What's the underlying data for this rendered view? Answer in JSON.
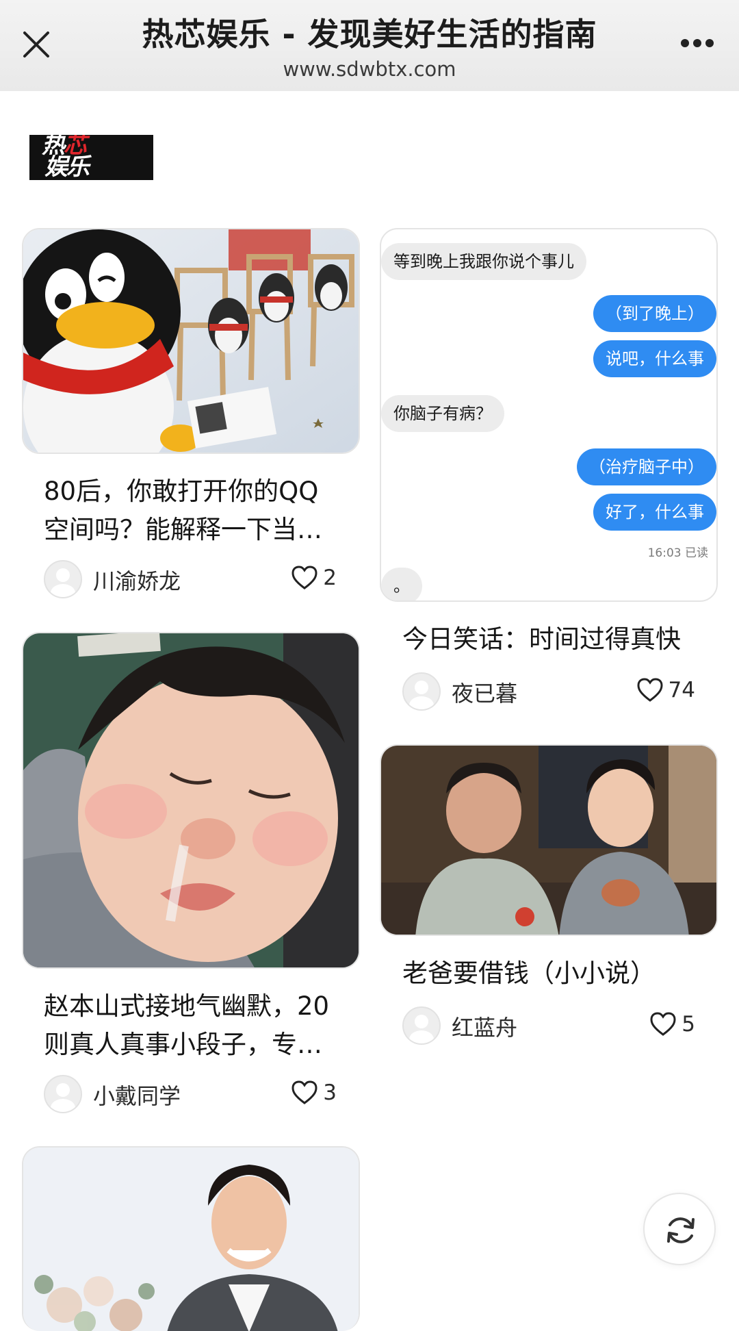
{
  "header": {
    "title": "热芯娱乐 - 发现美好生活的指南",
    "url": "www.sdwbtx.com",
    "close_icon": "close-icon",
    "more_icon": "more-dots-icon"
  },
  "brand": {
    "logo_line1_a": "热",
    "logo_line1_b": "芯",
    "logo_line2": "娱乐"
  },
  "cards": [
    {
      "image": "qq-penguin-plush-photo",
      "title": "80后，你敢打开你的QQ空间吗？能解释一下当…",
      "author": "川渝娇龙",
      "likes": "2"
    },
    {
      "image": "chat-screenshot",
      "title": "今日笑话：时间过得真快",
      "author": "夜已暮",
      "likes": "74",
      "chat": {
        "messages": [
          {
            "side": "in",
            "text": "等到晚上我跟你说个事儿"
          },
          {
            "side": "out",
            "text": "（到了晚上）"
          },
          {
            "side": "out",
            "text": "说吧，什么事"
          },
          {
            "side": "in",
            "text": "你脑子有病？"
          },
          {
            "side": "out",
            "text": "（治疗脑子中）"
          },
          {
            "side": "out",
            "text": "好了，什么事"
          },
          {
            "side": "in",
            "text": "。"
          }
        ],
        "read_stamp": "16:03 已读"
      }
    },
    {
      "image": "crying-child-photo",
      "title": "赵本山式接地气幽默，20则真人真事小段子，专…",
      "author": "小戴同学",
      "likes": "3"
    },
    {
      "image": "father-son-drama-still",
      "title": "老爸要借钱（小小说）",
      "author": "红蓝舟",
      "likes": "5"
    },
    {
      "image": "smiling-man-with-flowers-photo"
    }
  ],
  "fab": {
    "icon": "refresh-icon"
  },
  "colors": {
    "bubble_out": "#2f8cf2",
    "bubble_in": "#ececec",
    "header_bg": "#eeeeee",
    "logo_red": "#e0262c"
  }
}
